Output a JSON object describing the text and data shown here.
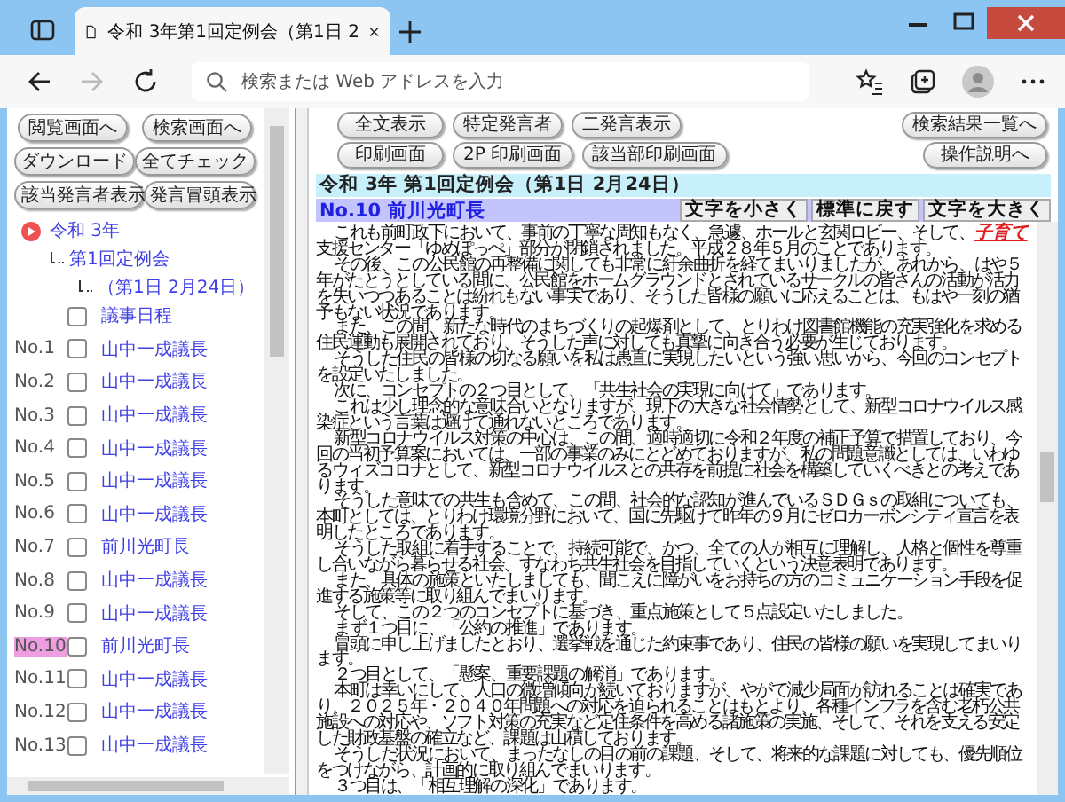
{
  "browser": {
    "tab_title": "令和 3年第1回定例会（第1日 2",
    "address_placeholder": "検索または Web アドレスを入力"
  },
  "left_pane": {
    "buttons": [
      [
        "閲覧画面へ",
        "検索画面へ"
      ],
      [
        "ダウンロード",
        "全てチェック"
      ],
      [
        "該当発言者表示",
        "発言冒頭表示"
      ]
    ],
    "tree": {
      "label": "令和 3年",
      "children": [
        {
          "label": "第1回定例会",
          "children": [
            {
              "label": "（第1日 2月24日）"
            }
          ]
        }
      ]
    },
    "items": [
      {
        "name": "議事日程",
        "checked": false,
        "selected": false
      },
      {
        "number": "No.1",
        "name": "山中一成議長",
        "checked": false,
        "selected": false
      },
      {
        "number": "No.2",
        "name": "山中一成議長",
        "checked": false,
        "selected": false
      },
      {
        "number": "No.3",
        "name": "山中一成議長",
        "checked": false,
        "selected": false
      },
      {
        "number": "No.4",
        "name": "山中一成議長",
        "checked": false,
        "selected": false
      },
      {
        "number": "No.5",
        "name": "山中一成議長",
        "checked": false,
        "selected": false
      },
      {
        "number": "No.6",
        "name": "山中一成議長",
        "checked": false,
        "selected": false
      },
      {
        "number": "No.7",
        "name": "前川光町長",
        "checked": false,
        "selected": false
      },
      {
        "number": "No.8",
        "name": "山中一成議長",
        "checked": false,
        "selected": false
      },
      {
        "number": "No.9",
        "name": "山中一成議長",
        "checked": false,
        "selected": false
      },
      {
        "number": "No.10",
        "name": "前川光町長",
        "checked": false,
        "selected": true
      },
      {
        "number": "No.11",
        "name": "山中一成議長",
        "checked": false,
        "selected": false
      },
      {
        "number": "No.12",
        "name": "山中一成議長",
        "checked": false,
        "selected": false
      },
      {
        "number": "No.13",
        "name": "山中一成議長",
        "checked": false,
        "selected": false
      }
    ]
  },
  "right_pane": {
    "button_rows": [
      [
        "全文表示",
        "特定発言者",
        "二発言表示"
      ],
      [
        "印刷画面",
        "2P 印刷画面",
        "該当部印刷画面"
      ]
    ],
    "side_buttons": [
      "検索結果一覧へ",
      "操作説明へ"
    ],
    "session_title": "令和 3年 第1回定例会（第1日 2月24日）",
    "speaker": "No.10 前川光町長",
    "font_buttons": [
      "文字を小さく",
      "標準に戻す",
      "文字を大きく"
    ],
    "paragraphs": [
      {
        "text": "これも前町政下において、事前の丁寧な周知もなく、急遽、ホールと玄関ロビー、そして、",
        "link": "子育て",
        "after": "支援センター「ゆめぽっぺ」部分が閉鎖されました。平成２８年５月のことであります。"
      },
      {
        "text": "その後、この公民館の再整備に関しても非常に紆余曲折を経てまいりましたが、あれから、はや５年がたとうとしている間に、公民館をホームグラウンドとされているサークルの皆さんの活動が活力を失いつつあることは紛れもない事実であり、そうした皆様の願いに応えることは、もはや一刻の猶予もない状況であります。"
      },
      {
        "text": "また、この間、新たな時代のまちづくりの起爆剤として、とりわけ図書館機能の充実強化を求める住民運動も展開されており、そうした声に対しても真摯に向き合う必要が生じております。"
      },
      {
        "text": "そうした住民の皆様の切なる願いを私は愚直に実現したいという強い思いから、今回のコンセプトを設定いたしました。"
      },
      {
        "text": "次に、コンセプトの２つ目として、「共生社会の実現に向けて」であります。"
      },
      {
        "text": "これは少し理念的な意味合いとなりますが、現下の大きな社会情勢として、新型コロナウイルス感染症という言葉は避けて通れないところであります。"
      },
      {
        "text": "新型コロナウイルス対策の中心は、この間、適時適切に令和２年度の補正予算で措置しており、今回の当初予算案においては、一部の事業のみにとどめておりますが、私の問題意識としては、いわゆるウィズコロナとして、新型コロナウイルスとの共存を前提に社会を構築していくべきとの考えであります。"
      },
      {
        "text": "そうした意味での共生も含めて、この間、社会的な認知が進んでいるＳＤＧｓの取組についても、本町としては、とりわけ環境分野において、国に先駆けて昨年の９月にゼロカーボンシティ宣言を表明したところであります。"
      },
      {
        "text": "そうした取組に着手することで、持続可能で、かつ、全ての人が相互に理解し、人格と個性を尊重し合いながら暮らせる社会、すなわち共生社会を目指していくという決意表明であります。"
      },
      {
        "text": "また、具体の施策といたしましても、聞こえに障がいをお持ちの方のコミュニケーション手段を促進する施策等に取り組んでまいります。"
      },
      {
        "text": "そして、この２つのコンセプトに基づき、重点施策として５点設定いたしました。"
      },
      {
        "text": "まず１つ目に、「公約の推進」であります。"
      },
      {
        "text": "冒頭に申し上げましたとおり、選挙戦を通じた約束事であり、住民の皆様の願いを実現してまいります。"
      },
      {
        "text": "２つ目として、「懸案、重要課題の解消」であります。"
      },
      {
        "text": "本町は幸いにして、人口の微増傾向が続いておりますが、やがて減少局面が訪れることは確実であり、２０２５年・２０４０年問題への対応を迫られることはもとより、各種インフラを含む老朽公共施設への対応や、ソフト対策の充実など定住条件を高める諸施策の実施、そして、それを支える安定した財政基盤の確立など、課題は山積しております。"
      },
      {
        "text": "そうした状況において、まったなしの目の前の課題、そして、将来的な課題に対しても、優先順位をつけながら、計画的に取り組んでまいります。"
      },
      {
        "text": "３つ目は、「相互理解の深化」であります。"
      }
    ]
  }
}
